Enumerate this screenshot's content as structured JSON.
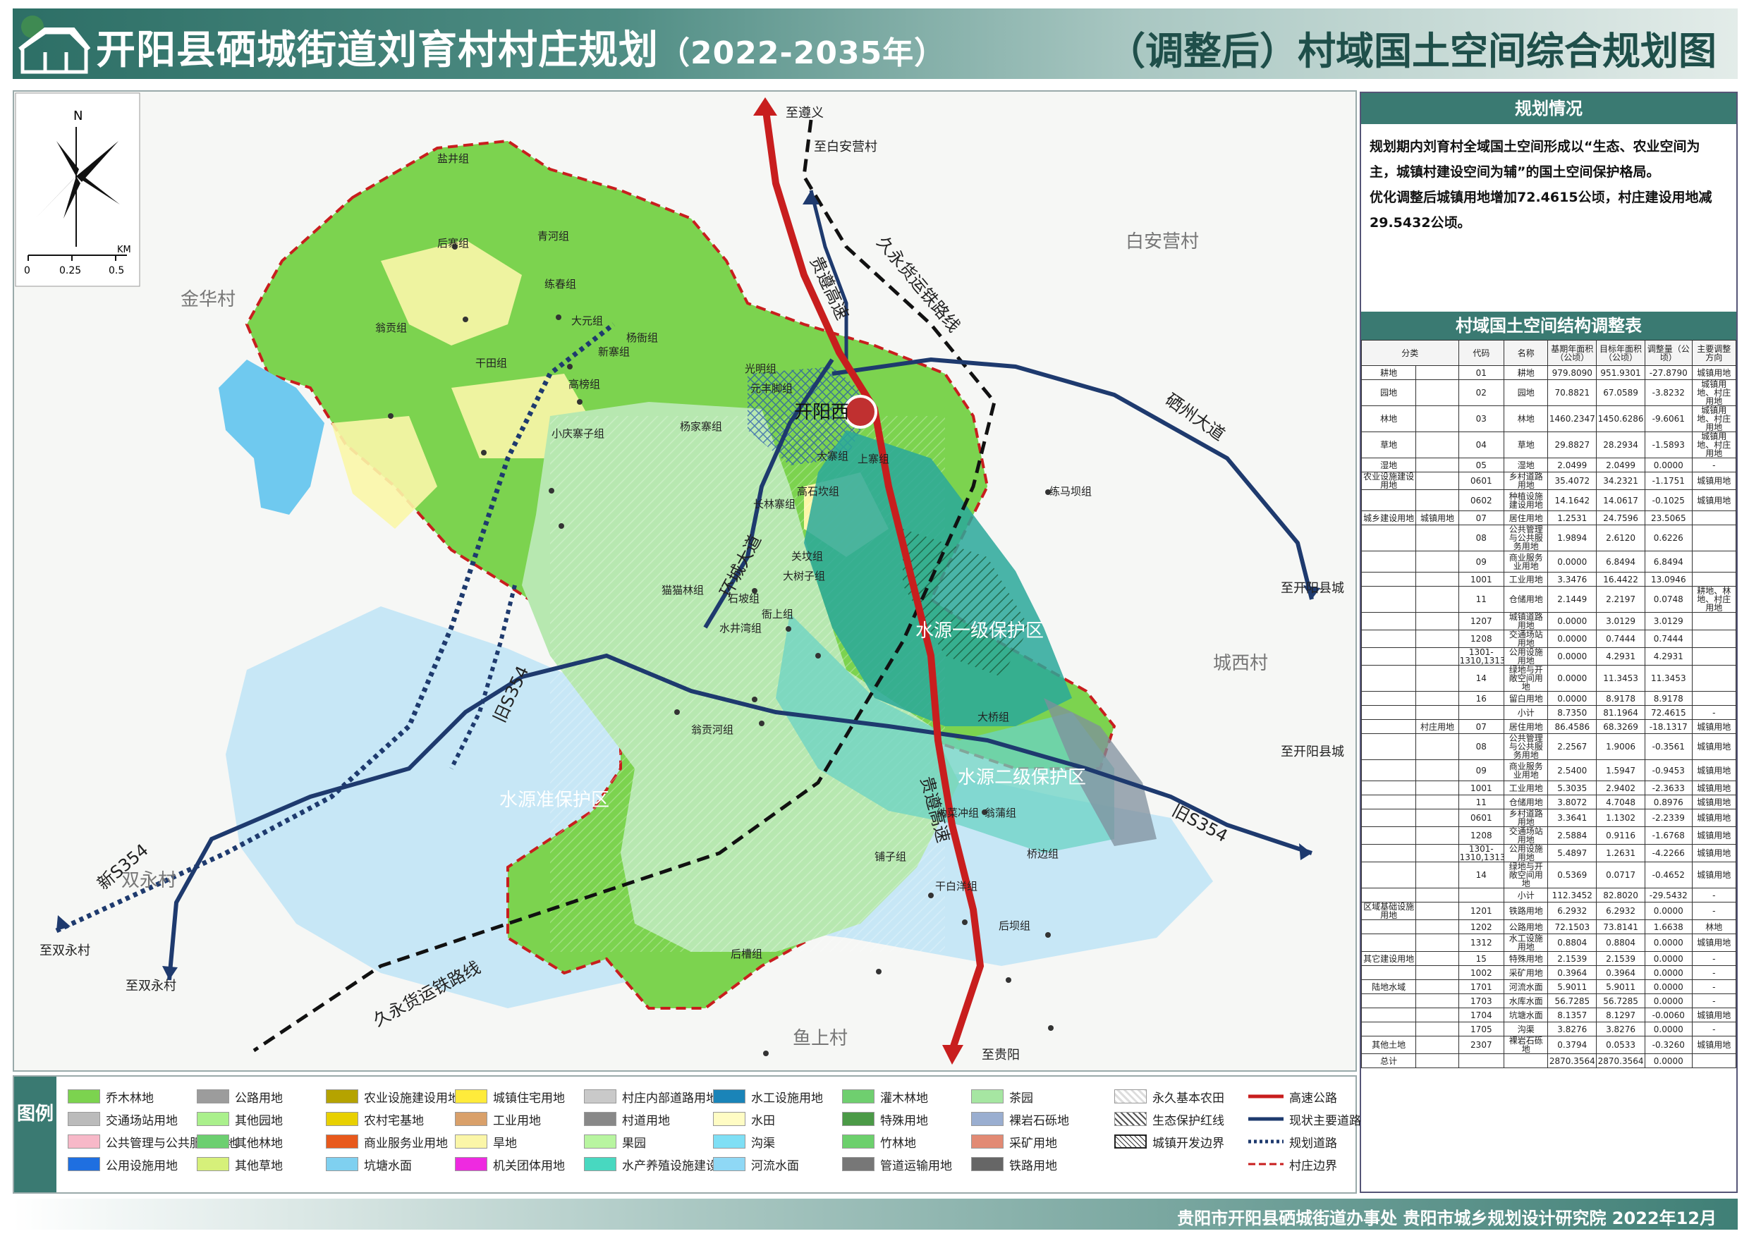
{
  "header": {
    "title": "开阳县硒城街道刘育村村庄规划",
    "period": "（2022-2035年）",
    "subtitle": "（调整后）村域国土空间综合规划图"
  },
  "map": {
    "north_label": "N",
    "scale_unit": "KM",
    "scale_ticks": [
      "0",
      "0.25",
      "0.5"
    ],
    "villages": [
      "金华村",
      "白安营村",
      "城西村",
      "双永村",
      "鱼上村"
    ],
    "directions": [
      "至遵义",
      "至白安营村",
      "至开阳县城",
      "至开阳县城",
      "至双永村",
      "至双永村",
      "至贵阳"
    ],
    "roads": [
      "贵遵高速",
      "贵遵高速",
      "久永货运铁路线",
      "久永货运铁路线",
      "硒州大道",
      "旧S354",
      "旧S354",
      "新S354",
      "环城大道"
    ],
    "zones": [
      "水源一级保护区",
      "水源二级保护区",
      "水源准保护区"
    ],
    "station": "开阳西",
    "groups": [
      "盐井组",
      "后寨组",
      "青河组",
      "练春组",
      "大元组",
      "翁贡组",
      "干田组",
      "杨衙组",
      "新寨组",
      "光明组",
      "元丰脚组",
      "高榜组",
      "小庆寨子组",
      "杨家寨组",
      "大寨组",
      "上寨组",
      "长林寨组",
      "高石坎组",
      "练马坝组",
      "关坟组",
      "大树子组",
      "猫猫林组",
      "石坡组",
      "衙上组",
      "水井湾组",
      "大桥组",
      "翁贡河组",
      "纳菜冲组",
      "翁蒲组",
      "桥边组",
      "铺子组",
      "干白洋组",
      "后坝组",
      "后槽组"
    ]
  },
  "panel": {
    "situation_title": "规划情况",
    "situation_lines": [
      "规划期内刘育村全域国土空间形成以“生态、农业空间为",
      "主，城镇村建设空间为辅”的国土空间保护格局。",
      "优化调整后城镇用地增加72.4615公顷，村庄建设用地减",
      "29.5432公顷。"
    ],
    "table_title": "村域国土空间结构调整表",
    "columns": [
      "分类",
      "代码",
      "名称",
      "基期年面积（公顷）",
      "目标年面积（公顷）",
      "调整量（公顷）",
      "主要调整方向"
    ],
    "rows": [
      [
        "耕地",
        "",
        "01",
        "耕地",
        "979.8090",
        "951.9301",
        "-27.8790",
        "城镇用地"
      ],
      [
        "园地",
        "",
        "02",
        "园地",
        "70.8821",
        "67.0589",
        "-3.8232",
        "城镇用地、村庄用地"
      ],
      [
        "林地",
        "",
        "03",
        "林地",
        "1460.2347",
        "1450.6286",
        "-9.6061",
        "城镇用地、村庄用地"
      ],
      [
        "草地",
        "",
        "04",
        "草地",
        "29.8827",
        "28.2934",
        "-1.5893",
        "城镇用地、村庄用地"
      ],
      [
        "湿地",
        "",
        "05",
        "湿地",
        "2.0499",
        "2.0499",
        "0.0000",
        "-"
      ],
      [
        "农业设施建设用地",
        "",
        "0601",
        "乡村道路用地",
        "35.4072",
        "34.2321",
        "-1.1751",
        "城镇用地"
      ],
      [
        "",
        "",
        "0602",
        "种植设施建设用地",
        "14.1642",
        "14.0617",
        "-0.1025",
        "城镇用地"
      ],
      [
        "城乡建设用地",
        "城镇用地",
        "07",
        "居住用地",
        "1.2531",
        "24.7596",
        "23.5065",
        ""
      ],
      [
        "",
        "",
        "08",
        "公共管理与公共服务用地",
        "1.9894",
        "2.6120",
        "0.6226",
        ""
      ],
      [
        "",
        "",
        "09",
        "商业服务业用地",
        "0.0000",
        "6.8494",
        "6.8494",
        ""
      ],
      [
        "",
        "",
        "1001",
        "工业用地",
        "3.3476",
        "16.4422",
        "13.0946",
        ""
      ],
      [
        "",
        "",
        "11",
        "仓储用地",
        "2.1449",
        "2.2197",
        "0.0748",
        "耕地、林地、村庄用地"
      ],
      [
        "",
        "",
        "1207",
        "城镇道路用地",
        "0.0000",
        "3.0129",
        "3.0129",
        ""
      ],
      [
        "",
        "",
        "1208",
        "交通场站用地",
        "0.0000",
        "0.7444",
        "0.7444",
        ""
      ],
      [
        "",
        "",
        "1301-1310,1313",
        "公用设施用地",
        "0.0000",
        "4.2931",
        "4.2931",
        ""
      ],
      [
        "",
        "",
        "14",
        "绿地与开敞空间用地",
        "0.0000",
        "11.3453",
        "11.3453",
        ""
      ],
      [
        "",
        "",
        "16",
        "留白用地",
        "0.0000",
        "8.9178",
        "8.9178",
        ""
      ],
      [
        "",
        "",
        "",
        "小计",
        "8.7350",
        "81.1964",
        "72.4615",
        "-"
      ],
      [
        "",
        "村庄用地",
        "07",
        "居住用地",
        "86.4586",
        "68.3269",
        "-18.1317",
        "城镇用地"
      ],
      [
        "",
        "",
        "08",
        "公共管理与公共服务用地",
        "2.2567",
        "1.9006",
        "-0.3561",
        "城镇用地"
      ],
      [
        "",
        "",
        "09",
        "商业服务业用地",
        "2.5400",
        "1.5947",
        "-0.9453",
        "城镇用地"
      ],
      [
        "",
        "",
        "1001",
        "工业用地",
        "5.3035",
        "2.9402",
        "-2.3633",
        "城镇用地"
      ],
      [
        "",
        "",
        "11",
        "仓储用地",
        "3.8072",
        "4.7048",
        "0.8976",
        "城镇用地"
      ],
      [
        "",
        "",
        "0601",
        "乡村道路用地",
        "3.3641",
        "1.1302",
        "-2.2339",
        "城镇用地"
      ],
      [
        "",
        "",
        "1208",
        "交通场站用地",
        "2.5884",
        "0.9116",
        "-1.6768",
        "城镇用地"
      ],
      [
        "",
        "",
        "1301-1310,1313",
        "公用设施用地",
        "5.4897",
        "1.2631",
        "-4.2266",
        "城镇用地"
      ],
      [
        "",
        "",
        "14",
        "绿地与开敞空间用地",
        "0.5369",
        "0.0717",
        "-0.4652",
        "城镇用地"
      ],
      [
        "",
        "",
        "",
        "小计",
        "112.3452",
        "82.8020",
        "-29.5432",
        "-"
      ],
      [
        "区域基础设施用地",
        "",
        "1201",
        "铁路用地",
        "6.2932",
        "6.2932",
        "0.0000",
        "-"
      ],
      [
        "",
        "",
        "1202",
        "公路用地",
        "72.1503",
        "73.8141",
        "1.6638",
        "林地"
      ],
      [
        "",
        "",
        "1312",
        "水工设施用地",
        "0.8804",
        "0.8804",
        "0.0000",
        "城镇用地"
      ],
      [
        "其它建设用地",
        "",
        "15",
        "特殊用地",
        "2.1539",
        "2.1539",
        "0.0000",
        "-"
      ],
      [
        "",
        "",
        "1002",
        "采矿用地",
        "0.3964",
        "0.3964",
        "0.0000",
        "-"
      ],
      [
        "陆地水域",
        "",
        "1701",
        "河流水面",
        "5.9011",
        "5.9011",
        "0.0000",
        "-"
      ],
      [
        "",
        "",
        "1703",
        "水库水面",
        "56.7285",
        "56.7285",
        "0.0000",
        "-"
      ],
      [
        "",
        "",
        "1704",
        "坑塘水面",
        "8.1357",
        "8.1297",
        "-0.0060",
        "城镇用地"
      ],
      [
        "",
        "",
        "1705",
        "沟渠",
        "3.8276",
        "3.8276",
        "0.0000",
        "-"
      ],
      [
        "其他土地",
        "",
        "2307",
        "裸岩石砾地",
        "0.3794",
        "0.0533",
        "-0.3260",
        "城镇用地"
      ],
      [
        "总计",
        "",
        "",
        "",
        "2870.3564",
        "2870.3564",
        "0.0000",
        ""
      ]
    ]
  },
  "legend": {
    "title": "图例",
    "items": [
      {
        "label": "乔木林地",
        "color": "#7cd34f"
      },
      {
        "label": "公路用地",
        "color": "#9c9c9c"
      },
      {
        "label": "农业设施建设用地",
        "color": "#b5a300"
      },
      {
        "label": "城镇住宅用地",
        "color": "#ffeb3b"
      },
      {
        "label": "村庄内部道路用地",
        "color": "#c9c9c9"
      },
      {
        "label": "水工设施用地",
        "color": "#1a84b8"
      },
      {
        "label": "灌木林地",
        "color": "#6fcf6f"
      },
      {
        "label": "茶园",
        "color": "#a6e6a2"
      },
      {
        "label": "交通场站用地",
        "color": "#bbbbbb"
      },
      {
        "label": "其他园地",
        "color": "#aaf08c"
      },
      {
        "label": "农村宅基地",
        "color": "#e8d000"
      },
      {
        "label": "工业用地",
        "color": "#d9a06a"
      },
      {
        "label": "村道用地",
        "color": "#888888"
      },
      {
        "label": "水田",
        "color": "#fffcc4"
      },
      {
        "label": "特殊用地",
        "color": "#4b9a47"
      },
      {
        "label": "裸岩石砾地",
        "color": "#9aaed0"
      },
      {
        "label": "公共管理与公共服务用地",
        "color": "#f7b8c8"
      },
      {
        "label": "其他林地",
        "color": "#6ccf70"
      },
      {
        "label": "商业服务业用地",
        "color": "#e8591c"
      },
      {
        "label": "旱地",
        "color": "#fbf6a8"
      },
      {
        "label": "果园",
        "color": "#b8f5a0"
      },
      {
        "label": "沟渠",
        "color": "#7fdff5"
      },
      {
        "label": "竹林地",
        "color": "#6cd06c"
      },
      {
        "label": "采矿用地",
        "color": "#e28a74"
      },
      {
        "label": "公用设施用地",
        "color": "#1f6fe0"
      },
      {
        "label": "其他草地",
        "color": "#d6f07a"
      },
      {
        "label": "坑塘水面",
        "color": "#7fd0f0"
      },
      {
        "label": "机关团体用地",
        "color": "#ee2ae0"
      },
      {
        "label": "水产养殖设施建设用地",
        "color": "#48d8c0"
      },
      {
        "label": "河流水面",
        "color": "#8fd8f5"
      },
      {
        "label": "管道运输用地",
        "color": "#777777"
      },
      {
        "label": "铁路用地",
        "color": "#666666"
      }
    ],
    "patterns": [
      "永久基本农田",
      "生态保护红线",
      "城镇开发边界"
    ],
    "lines": [
      {
        "label": "高速公路",
        "color": "#c81e1e"
      },
      {
        "label": "现状主要道路",
        "color": "#1e3a6e"
      },
      {
        "label": "规划道路",
        "color": "#1e3a6e"
      },
      {
        "label": "村庄边界",
        "color": "#c81e1e"
      }
    ]
  },
  "footer": {
    "text": "贵阳市开阳县硒城街道办事处   贵阳市城乡规划设计研究院   2022年12月"
  },
  "colors": {
    "banner": "#3a7a72",
    "forest": "#7cd34f",
    "water_reserve": "#bfe3f5",
    "primary_zone": "#2aa89a",
    "secondary_zone": "#6bd3c4",
    "highway": "#c81e1e",
    "road": "#1e3a6e"
  }
}
